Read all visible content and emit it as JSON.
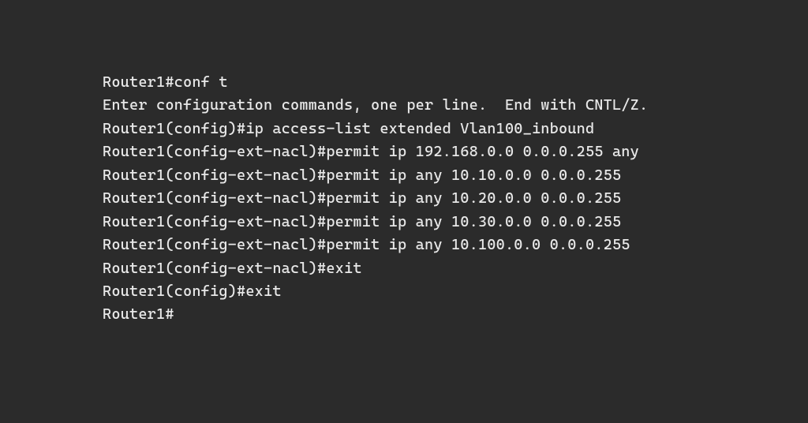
{
  "terminal": {
    "lines": [
      "Router1#conf t",
      "Enter configuration commands, one per line.  End with CNTL/Z.",
      "Router1(config)#ip access-list extended Vlan100_inbound",
      "Router1(config-ext-nacl)#permit ip 192.168.0.0 0.0.0.255 any",
      "Router1(config-ext-nacl)#permit ip any 10.10.0.0 0.0.0.255",
      "Router1(config-ext-nacl)#permit ip any 10.20.0.0 0.0.0.255",
      "Router1(config-ext-nacl)#permit ip any 10.30.0.0 0.0.0.255",
      "Router1(config-ext-nacl)#permit ip any 10.100.0.0 0.0.0.255",
      "Router1(config-ext-nacl)#exit",
      "Router1(config)#exit",
      "Router1#"
    ]
  }
}
